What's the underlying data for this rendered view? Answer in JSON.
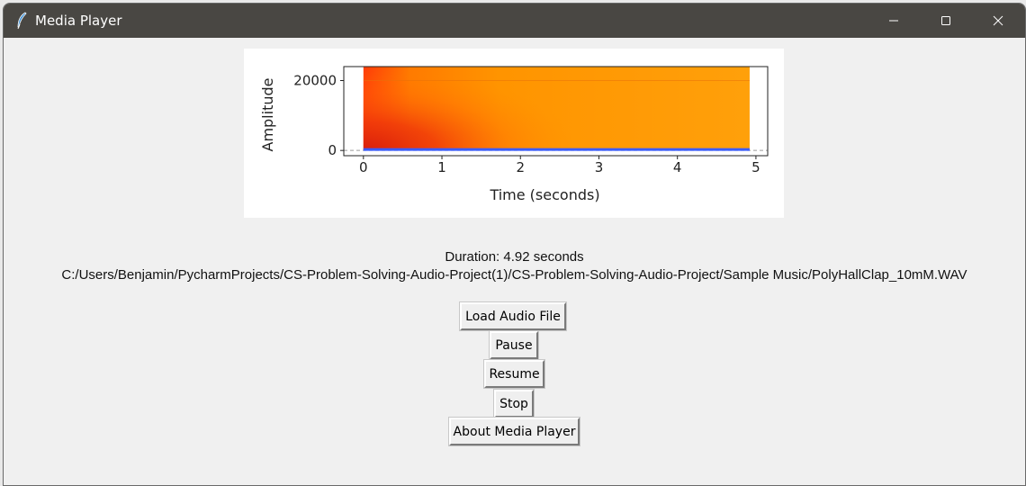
{
  "window": {
    "title": "Media Player",
    "controls": {
      "minimize_icon": "minimize-icon",
      "maximize_icon": "maximize-icon",
      "close_icon": "close-icon"
    }
  },
  "chart_data": {
    "type": "heatmap",
    "description_kind": "spectrogram",
    "xlabel": "Time (seconds)",
    "ylabel": "Amplitude",
    "x_ticks": [
      0,
      1,
      2,
      3,
      4,
      5
    ],
    "y_ticks": [
      0,
      20000
    ],
    "xlim": [
      -0.25,
      5.15
    ],
    "ylim": [
      -1500,
      24000
    ],
    "data_extent_x": [
      0,
      4.92
    ],
    "data_extent_y": [
      0,
      24000
    ],
    "colormap": [
      "#d81f0c",
      "#ff4a0a",
      "#ff8a00",
      "#ffa20c"
    ],
    "baseline_color": "#3a5cff"
  },
  "info": {
    "duration": "Duration: 4.92 seconds",
    "filepath": "C:/Users/Benjamin/PycharmProjects/CS-Problem-Solving-Audio-Project(1)/CS-Problem-Solving-Audio-Project/Sample Music/PolyHallClap_10mM.WAV"
  },
  "buttons": {
    "load": "Load Audio File",
    "pause": "Pause",
    "resume": "Resume",
    "stop": "Stop",
    "about": "About Media Player"
  },
  "colors": {
    "titlebar": "#494743",
    "window_bg": "#f0f0f0"
  }
}
